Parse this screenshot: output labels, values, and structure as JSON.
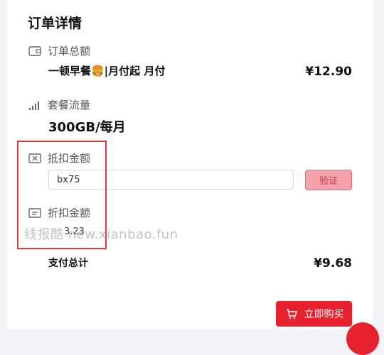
{
  "page": {
    "title": "订单详情"
  },
  "order_total": {
    "label": "订单总额",
    "plan": "一顿早餐🍔|月付起 月付",
    "price": "¥12.90",
    "icon": "wallet-icon"
  },
  "traffic": {
    "label": "套餐流量",
    "value": "300GB/每月",
    "icon": "signal-icon"
  },
  "deduction": {
    "label": "抵扣金额",
    "input_value": "bx75",
    "verify_label": "验证",
    "icon": "coupon-icon"
  },
  "discount": {
    "label": "折扣金额",
    "value": "3.23",
    "icon": "receipt-icon"
  },
  "watermark": {
    "text": "线报酷 new.xianbao.fun"
  },
  "summary": {
    "total_label": "支付总计",
    "total_value": "¥9.68"
  },
  "buy_button": {
    "label": "立即购买",
    "icon": "cart-icon"
  },
  "colors": {
    "accent": "#e8212e",
    "verify_bg": "#f5a3ab",
    "highlight": "#e23b3b"
  }
}
